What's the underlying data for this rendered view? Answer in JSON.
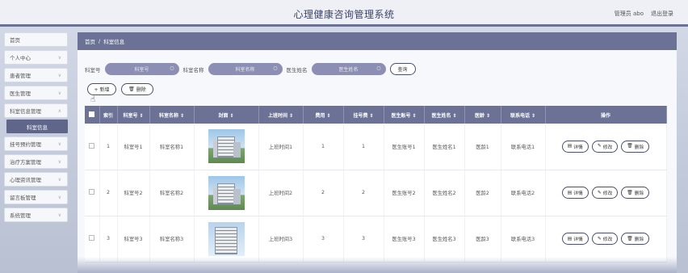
{
  "header": {
    "title": "心理健康咨询管理系统",
    "user": "管理员 abo",
    "logout": "退出登录"
  },
  "sidebar": {
    "items": [
      {
        "label": "首页",
        "chevron": false
      },
      {
        "label": "个人中心",
        "chevron": true
      },
      {
        "label": "患者管理",
        "chevron": true
      },
      {
        "label": "医生管理",
        "chevron": true
      },
      {
        "label": "科室信息管理",
        "chevron": true
      },
      {
        "label": "挂号预约管理",
        "chevron": true
      },
      {
        "label": "治疗方案管理",
        "chevron": true
      },
      {
        "label": "心理资讯管理",
        "chevron": true
      },
      {
        "label": "留言板管理",
        "chevron": true
      },
      {
        "label": "系统管理",
        "chevron": true
      }
    ],
    "active_sub": "科室信息"
  },
  "breadcrumb": {
    "home": "首页",
    "sep": "/",
    "current": "科室信息"
  },
  "search": {
    "field1_label": "科室号",
    "field1_placeholder": "科室号",
    "field2_label": "科室名称",
    "field2_placeholder": "科室名称",
    "field3_label": "医生姓名",
    "field3_placeholder": "医生姓名",
    "query": "查询"
  },
  "actions": {
    "add": "+ 新增",
    "delete": "删除"
  },
  "table": {
    "headers": [
      "索引",
      "科室号 ⇕",
      "科室名称 ⇕",
      "封面 ⇕",
      "上班时间 ⇕",
      "费用 ⇕",
      "挂号费 ⇕",
      "医生账号 ⇕",
      "医生姓名 ⇕",
      "医龄 ⇕",
      "联系电话 ⇕",
      "操作"
    ],
    "rows": [
      {
        "index": "1",
        "dept_no": "科室号1",
        "dept_name": "科室名称1",
        "work_time": "上班时间1",
        "fee": "1",
        "reg_fee": "1",
        "doc_account": "医生账号1",
        "doc_name": "医生姓名1",
        "doc_age": "医龄1",
        "phone": "联系电话1"
      },
      {
        "index": "2",
        "dept_no": "科室号2",
        "dept_name": "科室名称2",
        "work_time": "上班时间2",
        "fee": "2",
        "reg_fee": "2",
        "doc_account": "医生账号2",
        "doc_name": "医生姓名2",
        "doc_age": "医龄2",
        "phone": "联系电话2"
      },
      {
        "index": "3",
        "dept_no": "科室号3",
        "dept_name": "科室名称3",
        "work_time": "上班时间3",
        "fee": "3",
        "reg_fee": "3",
        "doc_account": "医生账号3",
        "doc_name": "医生姓名3",
        "doc_age": "医龄3",
        "phone": "联系电话3"
      }
    ],
    "op_detail": "详情",
    "op_edit": "修改",
    "op_delete": "删除"
  },
  "icons": {
    "search": "search-icon",
    "delete": "trash-icon",
    "detail": "doc-icon",
    "edit": "pencil-icon"
  },
  "colors": {
    "accent": "#6b7296",
    "pill": "#8c8fb3"
  }
}
